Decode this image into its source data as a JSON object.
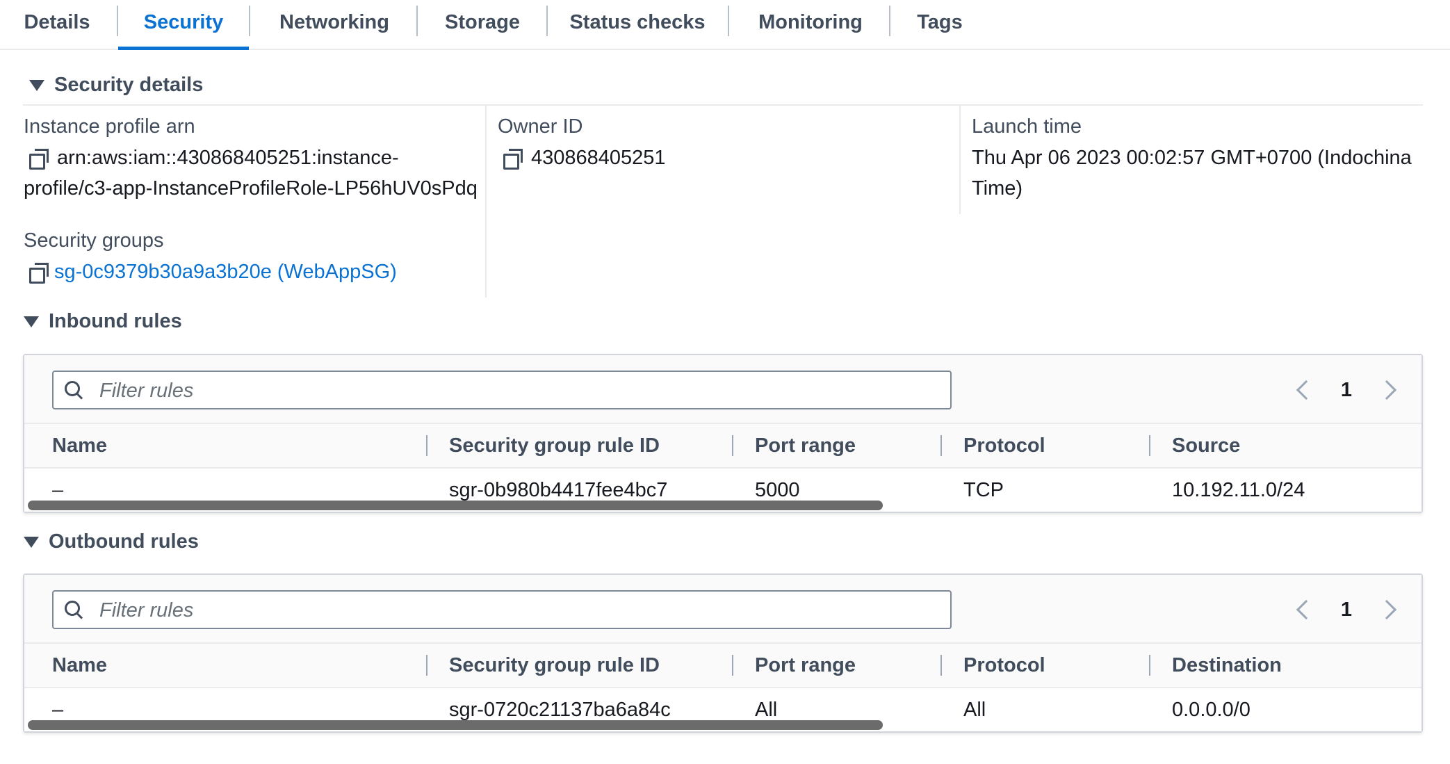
{
  "tabs": [
    "Details",
    "Security",
    "Networking",
    "Storage",
    "Status checks",
    "Monitoring",
    "Tags"
  ],
  "active_tab": "Security",
  "security_details": {
    "heading": "Security details",
    "instance_profile_label": "Instance profile arn",
    "instance_profile_line1": "arn:aws:iam::430868405251:instance-",
    "instance_profile_line2": "profile/c3-app-InstanceProfileRole-LP56hUV0sPdq",
    "owner_label": "Owner ID",
    "owner_value": "430868405251",
    "launch_label": "Launch time",
    "launch_line1": "Thu Apr 06 2023 00:02:57 GMT+0700 (Indochina",
    "launch_line2": "Time)",
    "sg_label": "Security groups",
    "sg_value": "sg-0c9379b30a9a3b20e (WebAppSG)"
  },
  "inbound": {
    "heading": "Inbound rules",
    "filter_placeholder": "Filter rules",
    "page": "1",
    "columns": [
      "Name",
      "Security group rule ID",
      "Port range",
      "Protocol",
      "Source"
    ],
    "rows": [
      [
        "–",
        "sgr-0b980b4417fee4bc7",
        "5000",
        "TCP",
        "10.192.11.0/24"
      ]
    ]
  },
  "outbound": {
    "heading": "Outbound rules",
    "filter_placeholder": "Filter rules",
    "page": "1",
    "columns": [
      "Name",
      "Security group rule ID",
      "Port range",
      "Protocol",
      "Destination"
    ],
    "rows": [
      [
        "–",
        "sgr-0720c21137ba6a84c",
        "All",
        "All",
        "0.0.0.0/0"
      ]
    ]
  },
  "colors": {
    "accent": "#0972d3",
    "text": "#16191f",
    "label": "#414d5c",
    "border": "#e9ebed"
  }
}
